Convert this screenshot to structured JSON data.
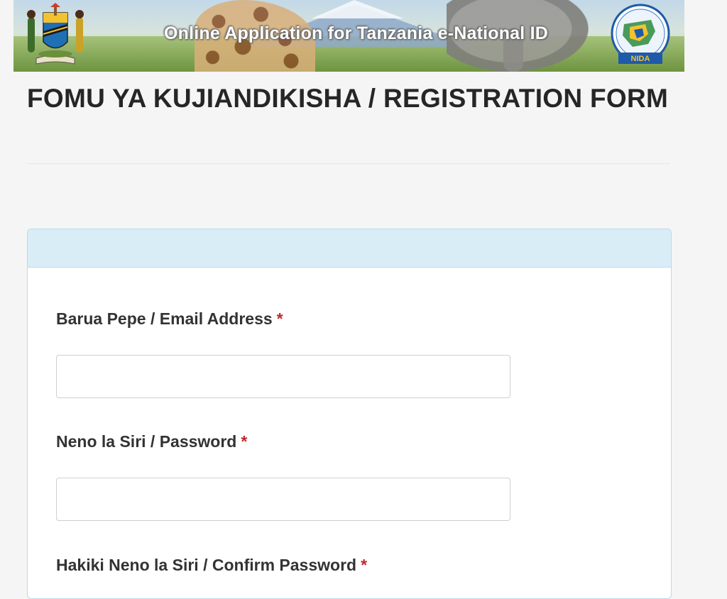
{
  "banner": {
    "title": "Online Application for Tanzania e-National ID",
    "emblem_icon": "tanzania-coat-of-arms-icon",
    "nida_logo_icon": "nida-logo-icon"
  },
  "page": {
    "title": "FOMU YA KUJIANDIKISHA / REGISTRATION FORM"
  },
  "form": {
    "required_marker": "*",
    "fields": [
      {
        "label": "Barua Pepe / Email Address",
        "value": "",
        "placeholder": ""
      },
      {
        "label": "Neno la Siri / Password",
        "value": "",
        "placeholder": ""
      },
      {
        "label": "Hakiki Neno la Siri / Confirm Password",
        "value": "",
        "placeholder": ""
      }
    ]
  },
  "colors": {
    "panel_header": "#d9edf7",
    "panel_border": "#bcd8e8",
    "required": "#c0282d",
    "title_text": "#262626"
  }
}
